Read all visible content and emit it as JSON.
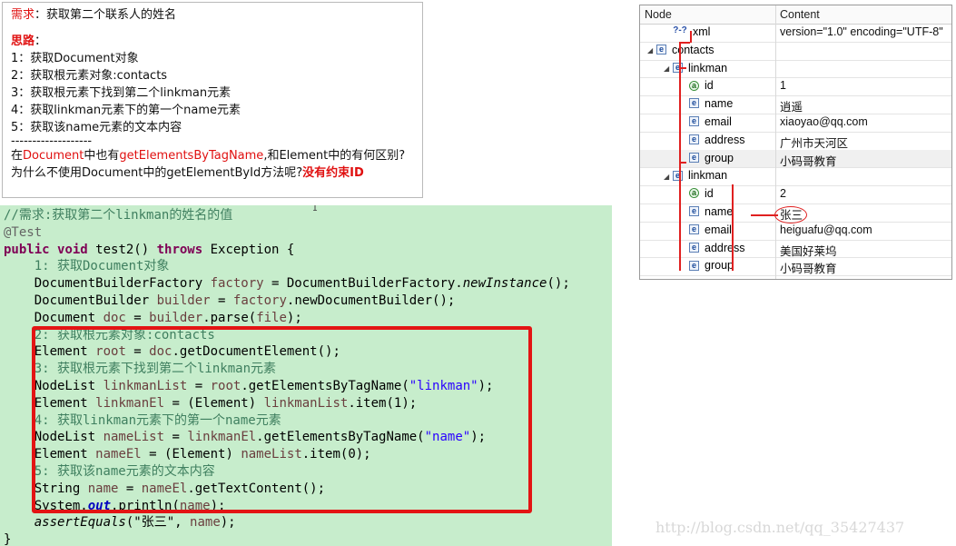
{
  "note": {
    "req_label": "需求",
    "req_text": "：获取第二个联系人的姓名",
    "idea_label": "思路",
    "idea_colon": "：",
    "steps": [
      "1：获取Document对象",
      "2：获取根元素对象:contacts",
      "3：获取根元素下找到第二个linkman元素",
      "4：获取linkman元素下的第一个name元素",
      "5：获取该name元素的文本内容"
    ],
    "divider": "-------------------",
    "q_part1": "在",
    "q_doc": "Document",
    "q_part2": "中也有",
    "q_method": "getElementsByTagName",
    "q_part3": ",和Element中的有何区别?",
    "q2_part1": "为什么不使用Document中的getElementById方法呢?",
    "q2_answer": "没有约束ID"
  },
  "code": {
    "lines": [
      {
        "tokens": [
          {
            "c": "cmt",
            "t": "//需求:获取第二个"
          },
          {
            "c": "cmt",
            "t": "linkman"
          },
          {
            "c": "cmt",
            "t": "的姓名的值"
          }
        ]
      },
      {
        "tokens": [
          {
            "c": "ann",
            "t": "@Test"
          }
        ]
      },
      {
        "tokens": [
          {
            "c": "kw",
            "t": "public"
          },
          {
            "c": "",
            "t": " "
          },
          {
            "c": "kw",
            "t": "void"
          },
          {
            "c": "",
            "t": " test2() "
          },
          {
            "c": "kw",
            "t": "throws"
          },
          {
            "c": "",
            "t": " Exception {"
          }
        ]
      },
      {
        "tokens": [
          {
            "c": "",
            "t": "    "
          },
          {
            "c": "cmt",
            "t": "1: 获取Document对象"
          }
        ]
      },
      {
        "tokens": [
          {
            "c": "",
            "t": "    DocumentBuilderFactory "
          },
          {
            "c": "var",
            "t": "factory"
          },
          {
            "c": "",
            "t": " = DocumentBuilderFactory."
          },
          {
            "c": "ital",
            "t": "newInstance"
          },
          {
            "c": "",
            "t": "();"
          }
        ]
      },
      {
        "tokens": [
          {
            "c": "",
            "t": "    DocumentBuilder "
          },
          {
            "c": "var",
            "t": "builder"
          },
          {
            "c": "",
            "t": " = "
          },
          {
            "c": "var",
            "t": "factory"
          },
          {
            "c": "",
            "t": ".newDocumentBuilder();"
          }
        ]
      },
      {
        "tokens": [
          {
            "c": "",
            "t": "    Document "
          },
          {
            "c": "var",
            "t": "doc"
          },
          {
            "c": "",
            "t": " = "
          },
          {
            "c": "var",
            "t": "builder"
          },
          {
            "c": "",
            "t": ".parse("
          },
          {
            "c": "var",
            "t": "file"
          },
          {
            "c": "",
            "t": ");"
          }
        ]
      },
      {
        "tokens": [
          {
            "c": "",
            "t": "    "
          },
          {
            "c": "cmt",
            "t": "2: 获取根元素对象:contacts"
          }
        ]
      },
      {
        "tokens": [
          {
            "c": "",
            "t": "    Element "
          },
          {
            "c": "var",
            "t": "root"
          },
          {
            "c": "",
            "t": " = "
          },
          {
            "c": "var",
            "t": "doc"
          },
          {
            "c": "",
            "t": ".getDocumentElement();"
          }
        ]
      },
      {
        "tokens": [
          {
            "c": "",
            "t": "    "
          },
          {
            "c": "cmt",
            "t": "3: 获取根元素下找到第二个linkman元素"
          }
        ]
      },
      {
        "tokens": [
          {
            "c": "",
            "t": "    NodeList "
          },
          {
            "c": "var",
            "t": "linkmanList"
          },
          {
            "c": "",
            "t": " = "
          },
          {
            "c": "var",
            "t": "root"
          },
          {
            "c": "",
            "t": ".getElementsByTagName("
          },
          {
            "c": "str",
            "t": "\"linkman\""
          },
          {
            "c": "",
            "t": ");"
          }
        ]
      },
      {
        "tokens": [
          {
            "c": "",
            "t": "    Element "
          },
          {
            "c": "var",
            "t": "linkmanEl"
          },
          {
            "c": "",
            "t": " = (Element) "
          },
          {
            "c": "var",
            "t": "linkmanList"
          },
          {
            "c": "",
            "t": ".item(1);"
          }
        ]
      },
      {
        "tokens": [
          {
            "c": "",
            "t": "    "
          },
          {
            "c": "cmt",
            "t": "4: 获取linkman元素下的第一个name元素"
          }
        ]
      },
      {
        "tokens": [
          {
            "c": "",
            "t": "    NodeList "
          },
          {
            "c": "var",
            "t": "nameList"
          },
          {
            "c": "",
            "t": " = "
          },
          {
            "c": "var",
            "t": "linkmanEl"
          },
          {
            "c": "",
            "t": ".getElementsByTagName("
          },
          {
            "c": "str",
            "t": "\"name\""
          },
          {
            "c": "",
            "t": ");"
          }
        ]
      },
      {
        "tokens": [
          {
            "c": "",
            "t": "    Element "
          },
          {
            "c": "var",
            "t": "nameEl"
          },
          {
            "c": "",
            "t": " = (Element) "
          },
          {
            "c": "var",
            "t": "nameList"
          },
          {
            "c": "",
            "t": ".item(0);"
          }
        ]
      },
      {
        "tokens": [
          {
            "c": "",
            "t": "    "
          },
          {
            "c": "cmt",
            "t": "5: 获取该name元素的文本内容"
          }
        ]
      },
      {
        "tokens": [
          {
            "c": "",
            "t": "    String "
          },
          {
            "c": "var",
            "t": "name"
          },
          {
            "c": "",
            "t": " = "
          },
          {
            "c": "var",
            "t": "nameEl"
          },
          {
            "c": "",
            "t": ".getTextContent();"
          }
        ]
      },
      {
        "tokens": [
          {
            "c": "",
            "t": "    System."
          },
          {
            "c": "fld",
            "t": "out"
          },
          {
            "c": "",
            "t": ".println("
          },
          {
            "c": "var",
            "t": "name"
          },
          {
            "c": "",
            "t": ");"
          }
        ]
      },
      {
        "tokens": [
          {
            "c": "",
            "t": "    "
          },
          {
            "c": "ital",
            "t": "assertEquals"
          },
          {
            "c": "",
            "t": "(\"张三\", "
          },
          {
            "c": "var",
            "t": "name"
          },
          {
            "c": "",
            "t": ");"
          }
        ]
      },
      {
        "tokens": [
          {
            "c": "",
            "t": "}"
          }
        ]
      }
    ]
  },
  "tree": {
    "col_node": "Node",
    "col_content": "Content",
    "rows": [
      {
        "depth": 1,
        "icon": "decl",
        "icon_text": "?-?",
        "tri": "",
        "label": "xml",
        "value": "version=\"1.0\" encoding=\"UTF-8\""
      },
      {
        "depth": 0,
        "icon": "elem",
        "icon_text": "e",
        "tri": "◢",
        "label": "contacts",
        "value": ""
      },
      {
        "depth": 1,
        "icon": "elem",
        "icon_text": "e",
        "tri": "◢",
        "label": "linkman",
        "value": ""
      },
      {
        "depth": 2,
        "icon": "attr",
        "icon_text": "a",
        "tri": "",
        "label": "id",
        "value": "1"
      },
      {
        "depth": 2,
        "icon": "elem",
        "icon_text": "e",
        "tri": "",
        "label": "name",
        "value": "逍遥"
      },
      {
        "depth": 2,
        "icon": "elem",
        "icon_text": "e",
        "tri": "",
        "label": "email",
        "value": "xiaoyao@qq.com"
      },
      {
        "depth": 2,
        "icon": "elem",
        "icon_text": "e",
        "tri": "",
        "label": "address",
        "value": "广州市天河区"
      },
      {
        "depth": 2,
        "icon": "elem",
        "icon_text": "e",
        "tri": "",
        "label": "group",
        "value": "小码哥教育",
        "selected": true
      },
      {
        "depth": 1,
        "icon": "elem",
        "icon_text": "e",
        "tri": "◢",
        "label": "linkman",
        "value": ""
      },
      {
        "depth": 2,
        "icon": "attr",
        "icon_text": "a",
        "tri": "",
        "label": "id",
        "value": "2"
      },
      {
        "depth": 2,
        "icon": "elem",
        "icon_text": "e",
        "tri": "",
        "label": "name",
        "value": "张三"
      },
      {
        "depth": 2,
        "icon": "elem",
        "icon_text": "e",
        "tri": "",
        "label": "email",
        "value": "heiguafu@qq.com"
      },
      {
        "depth": 2,
        "icon": "elem",
        "icon_text": "e",
        "tri": "",
        "label": "address",
        "value": "美国好莱坞"
      },
      {
        "depth": 2,
        "icon": "elem",
        "icon_text": "e",
        "tri": "",
        "label": "group",
        "value": "小码哥教育"
      }
    ]
  },
  "watermark": "http://blog.csdn.net/qq_35427437",
  "colors": {
    "accent_red": "#e01010",
    "code_bg": "#c7edcc"
  }
}
